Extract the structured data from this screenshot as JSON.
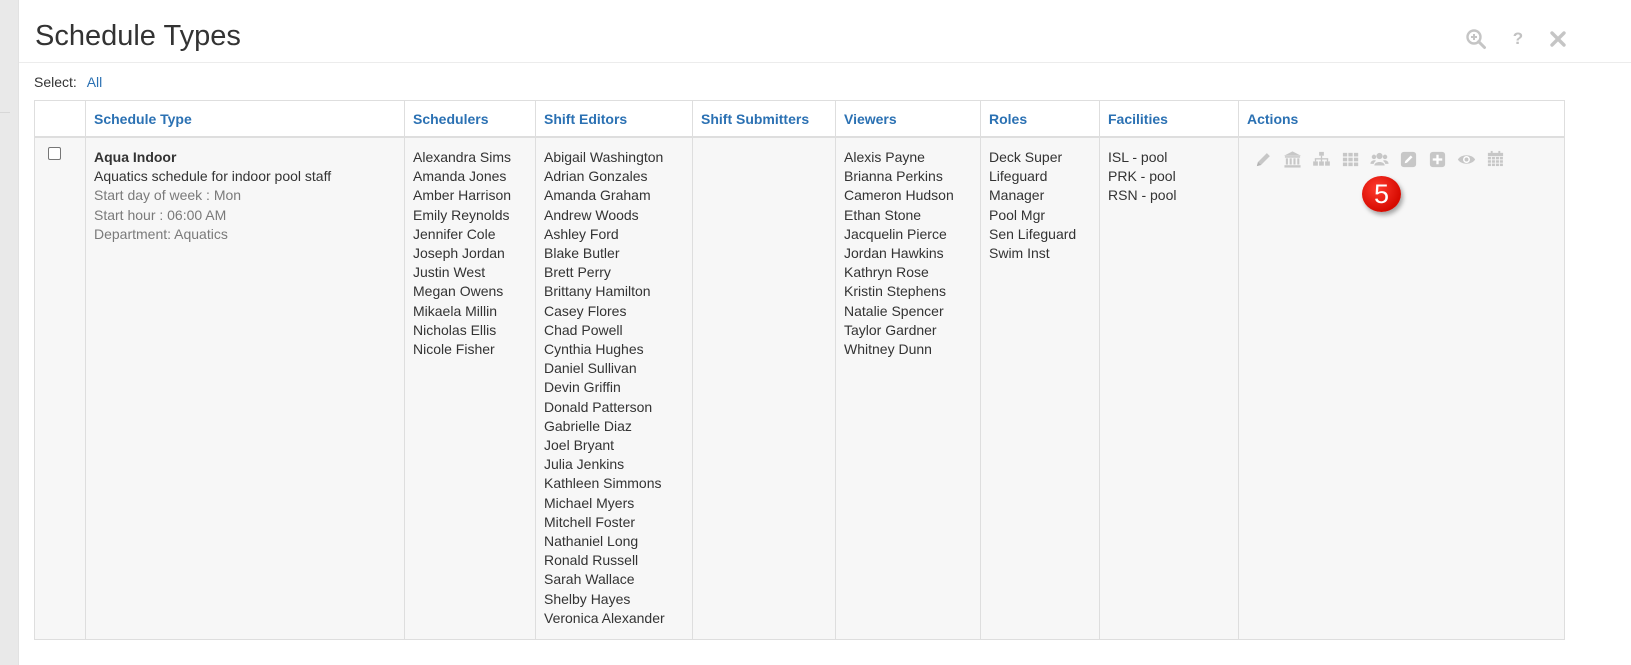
{
  "header": {
    "title": "Schedule Types",
    "help_label": "?"
  },
  "select": {
    "label": "Select:",
    "all_link": "All"
  },
  "table": {
    "columns": [
      "Schedule Type",
      "Schedulers",
      "Shift Editors",
      "Shift Submitters",
      "Viewers",
      "Roles",
      "Facilities",
      "Actions"
    ],
    "row": {
      "name": "Aqua Indoor",
      "description": "Aquatics schedule for indoor pool staff",
      "start_day": "Start day of week : Mon",
      "start_hour": "Start hour : 06:00 AM",
      "department": "Department: Aquatics",
      "schedulers": [
        "Alexandra Sims",
        "Amanda Jones",
        "Amber Harrison",
        "Emily Reynolds",
        "Jennifer Cole",
        "Joseph Jordan",
        "Justin West",
        "Megan Owens",
        "Mikaela Millin",
        "Nicholas Ellis",
        "Nicole Fisher"
      ],
      "shift_editors": [
        "Abigail Washington",
        "Adrian Gonzales",
        "Amanda Graham",
        "Andrew Woods",
        "Ashley Ford",
        "Blake Butler",
        "Brett Perry",
        "Brittany Hamilton",
        "Casey Flores",
        "Chad Powell",
        "Cynthia Hughes",
        "Daniel Sullivan",
        "Devin Griffin",
        "Donald Patterson",
        "Gabrielle Diaz",
        "Joel Bryant",
        "Julia Jenkins",
        "Kathleen Simmons",
        "Michael Myers",
        "Mitchell Foster",
        "Nathaniel Long",
        "Ronald Russell",
        "Sarah Wallace",
        "Shelby Hayes",
        "Veronica Alexander"
      ],
      "shift_submitters": [],
      "viewers": [
        "Alexis Payne",
        "Brianna Perkins",
        "Cameron Hudson",
        "Ethan Stone",
        "Jacquelin Pierce",
        "Jordan Hawkins",
        "Kathryn Rose",
        "Kristin Stephens",
        "Natalie Spencer",
        "Taylor Gardner",
        "Whitney Dunn"
      ],
      "roles": [
        "Deck Super",
        "Lifeguard",
        "Manager",
        "Pool Mgr",
        "Sen Lifeguard",
        "Swim Inst"
      ],
      "facilities": [
        "ISL - pool",
        "PRK - pool",
        "RSN - pool"
      ]
    },
    "action_icons": [
      "pencil-icon",
      "bank-icon",
      "sitemap-icon",
      "grid-icon",
      "users-icon",
      "edit-square-icon",
      "plus-square-icon",
      "eye-icon",
      "calendar-icon"
    ]
  },
  "callout": {
    "label": "5"
  },
  "colors": {
    "link": "#2b71b3",
    "icon": "#c7c7c7",
    "cell_bg": "#f7f7f7",
    "callout": "#e01006"
  }
}
